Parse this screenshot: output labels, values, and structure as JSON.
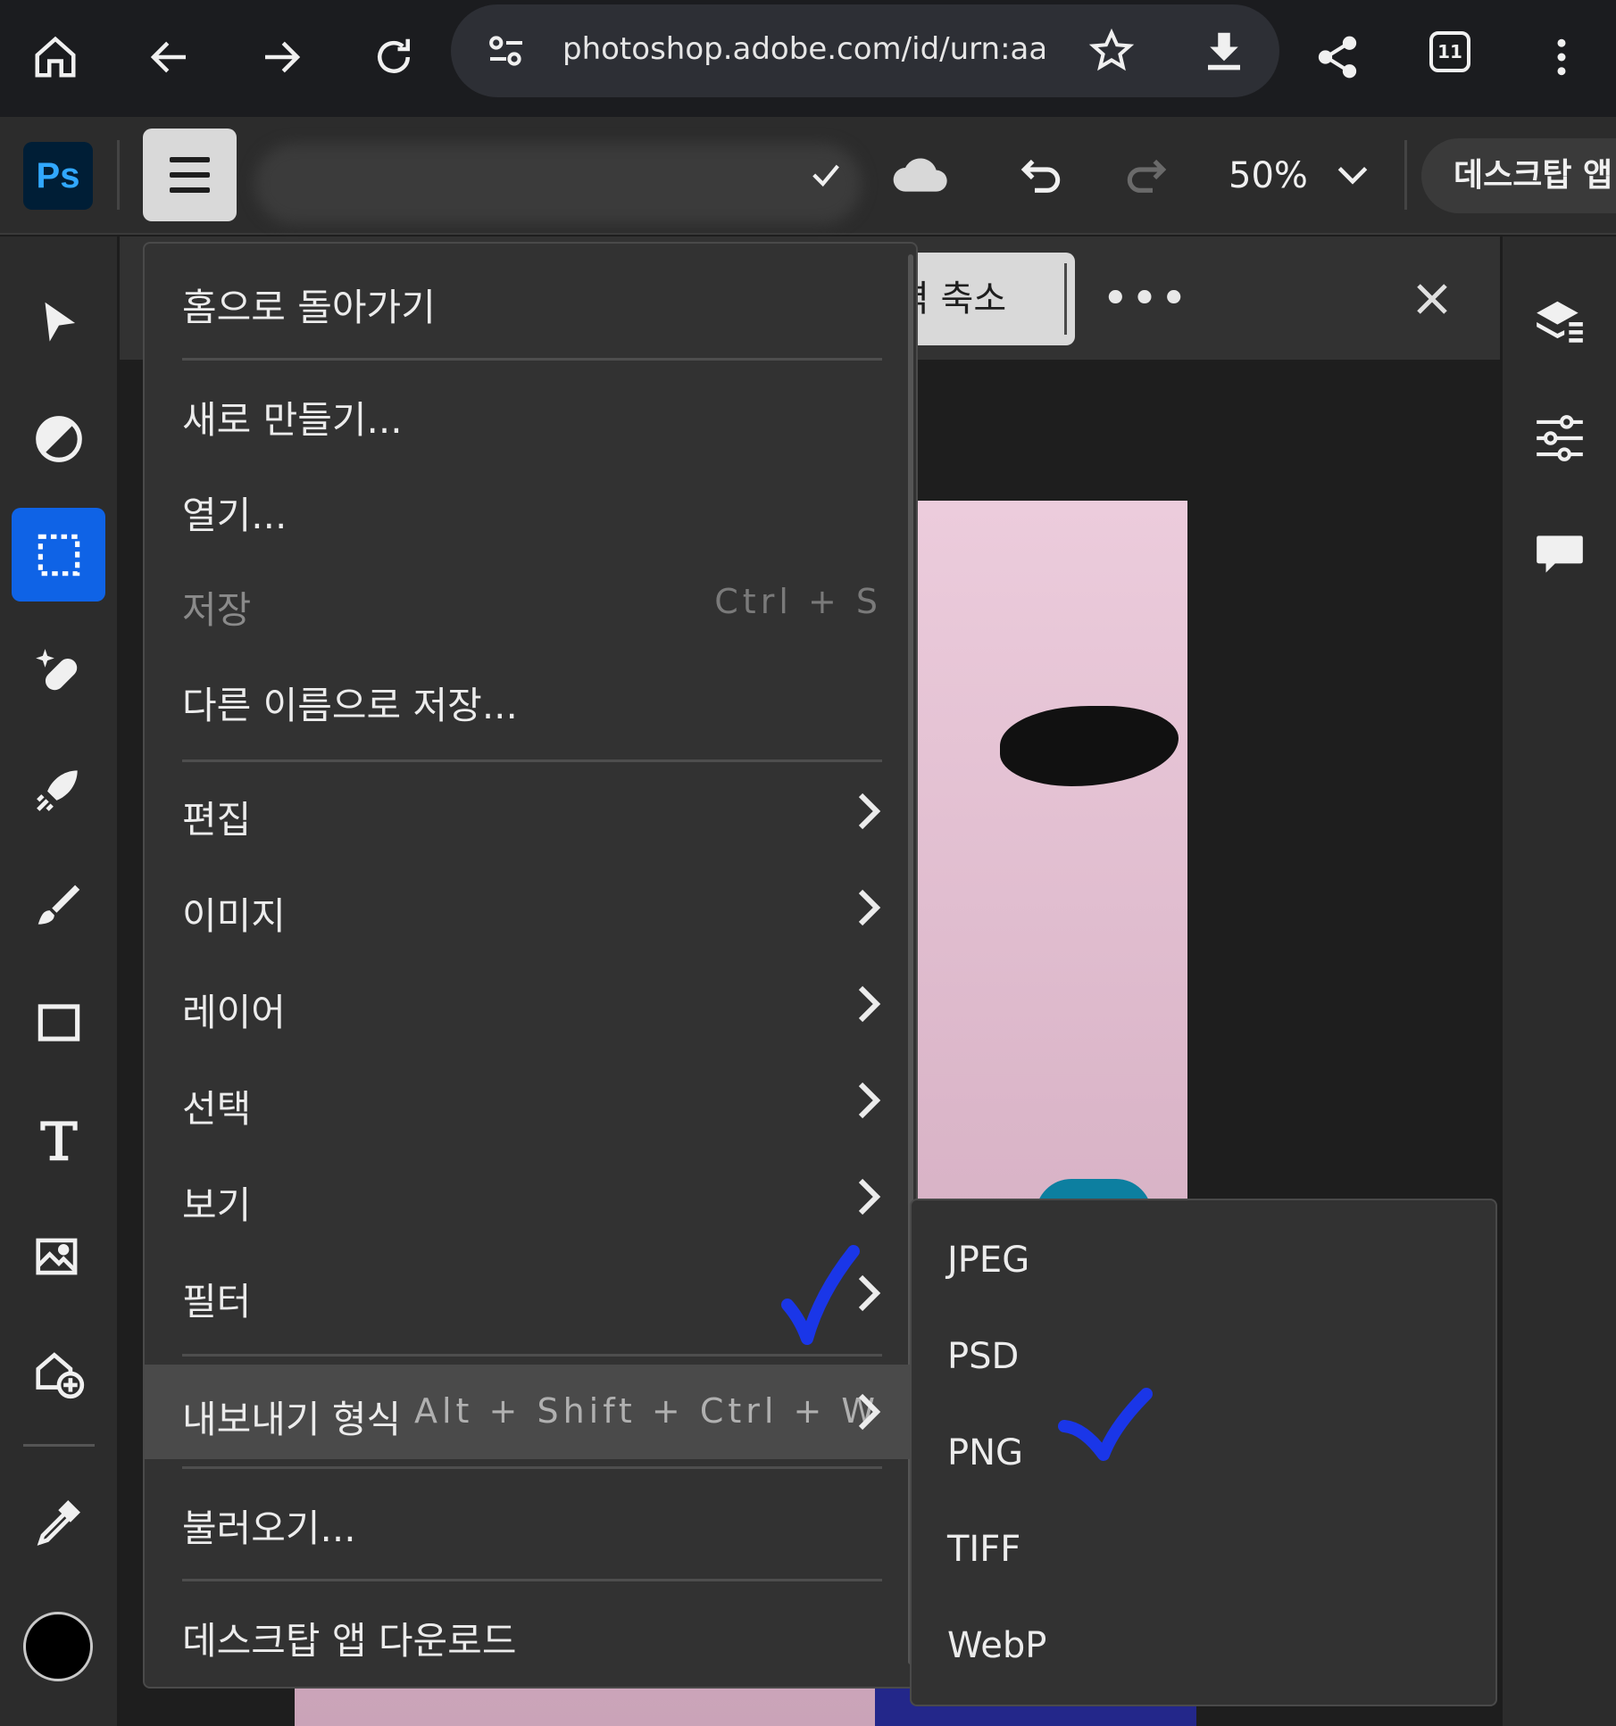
{
  "browser": {
    "url": "photoshop.adobe.com/id/urn:aaid:sc",
    "tab_count": "11",
    "icons": [
      "home-icon",
      "back-icon",
      "forward-icon",
      "reload-icon",
      "site-settings-icon",
      "bookmark-star-icon",
      "download-icon",
      "share-icon",
      "tabs-icon",
      "more-vert-icon"
    ]
  },
  "app_bar": {
    "logo": "Ps",
    "zoom": "50%",
    "desktop_app_button": "데스크탑 앱"
  },
  "context_bar": {
    "button_label": "벽 축소",
    "more_label": "•••"
  },
  "main_menu": {
    "home": "홈으로 돌아가기",
    "new": "새로 만들기...",
    "open": "열기...",
    "save": "저장",
    "save_shortcut": "Ctrl + S",
    "save_as": "다른 이름으로 저장...",
    "edit": "편집",
    "image": "이미지",
    "layer": "레이어",
    "select": "선택",
    "view": "보기",
    "filter": "필터",
    "export_as": "내보내기 형식",
    "export_shortcut": "Alt + Shift + Ctrl + W",
    "import": "불러오기...",
    "download_desktop": "데스크탑 앱 다운로드"
  },
  "export_submenu": {
    "items": [
      "JPEG",
      "PSD",
      "PNG",
      "TIFF",
      "WebP"
    ]
  },
  "colors": {
    "accent": "#0f63e6",
    "annotation_check": "#1a36e8",
    "foreground_color": "#000000"
  }
}
